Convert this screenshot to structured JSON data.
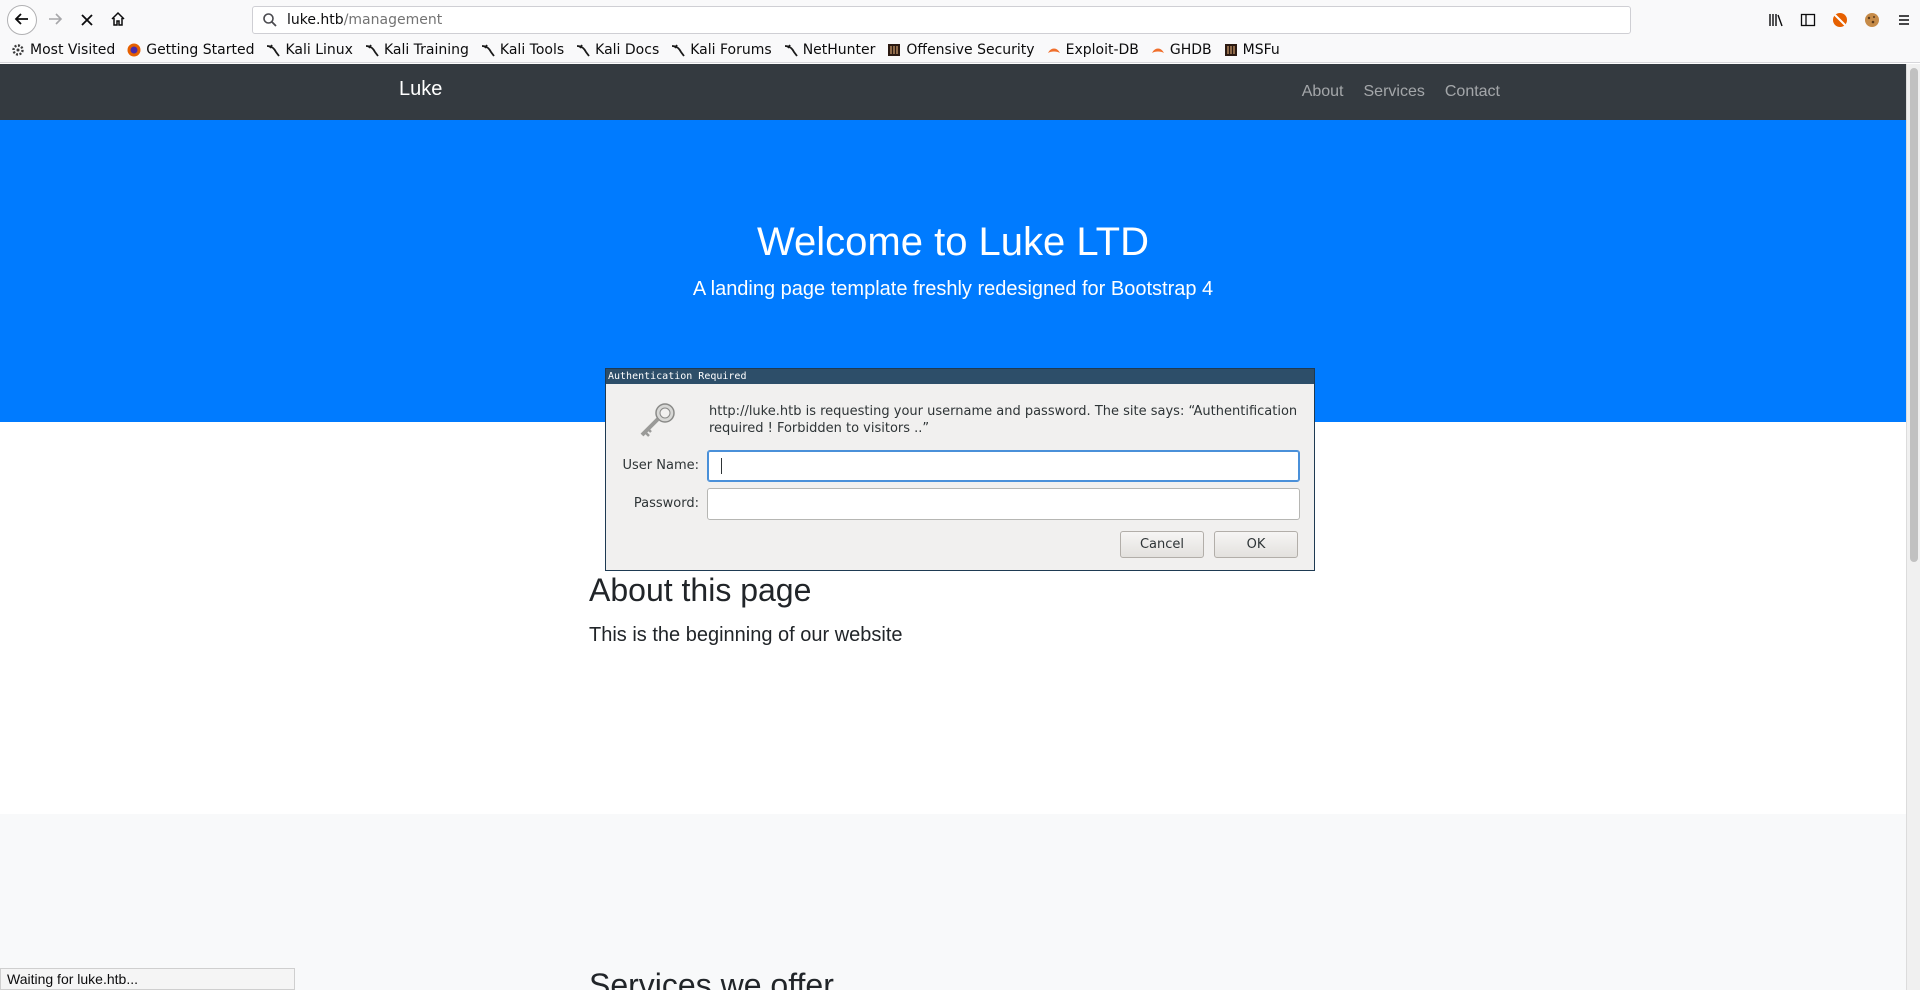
{
  "browser": {
    "url_host": "luke.htb",
    "url_path": "/management",
    "bookmarks": [
      {
        "label": "Most Visited",
        "icon": "gear-icon"
      },
      {
        "label": "Getting Started",
        "icon": "firefox-icon"
      },
      {
        "label": "Kali Linux",
        "icon": "kali-dragon-icon"
      },
      {
        "label": "Kali Training",
        "icon": "kali-dragon-icon"
      },
      {
        "label": "Kali Tools",
        "icon": "kali-dragon-icon"
      },
      {
        "label": "Kali Docs",
        "icon": "kali-dragon-icon"
      },
      {
        "label": "Kali Forums",
        "icon": "kali-dragon-icon"
      },
      {
        "label": "NetHunter",
        "icon": "kali-dragon-icon"
      },
      {
        "label": "Offensive Security",
        "icon": "offsec-icon"
      },
      {
        "label": "Exploit-DB",
        "icon": "exploitdb-icon"
      },
      {
        "label": "GHDB",
        "icon": "exploitdb-icon"
      },
      {
        "label": "MSFu",
        "icon": "offsec-icon"
      }
    ],
    "status": "Waiting for luke.htb..."
  },
  "site": {
    "brand": "Luke",
    "nav": [
      "About",
      "Services",
      "Contact"
    ],
    "hero_title": "Welcome to Luke LTD",
    "hero_subtitle": "A landing page template freshly redesigned for Bootstrap 4",
    "about_title": "About this page",
    "about_text": "This is the beginning of our website",
    "services_title": "Services we offer"
  },
  "dialog": {
    "title": "Authentication Required",
    "message": "http://luke.htb is requesting your username and password. The site says: “Authentification required ! Forbidden to visitors ..”",
    "username_label": "User Name:",
    "username_value": "",
    "password_label": "Password:",
    "password_value": "",
    "cancel_label": "Cancel",
    "ok_label": "OK"
  },
  "colors": {
    "hero": "#007bff",
    "navbar": "#343a40",
    "dialog_title": "#2d4e69"
  }
}
